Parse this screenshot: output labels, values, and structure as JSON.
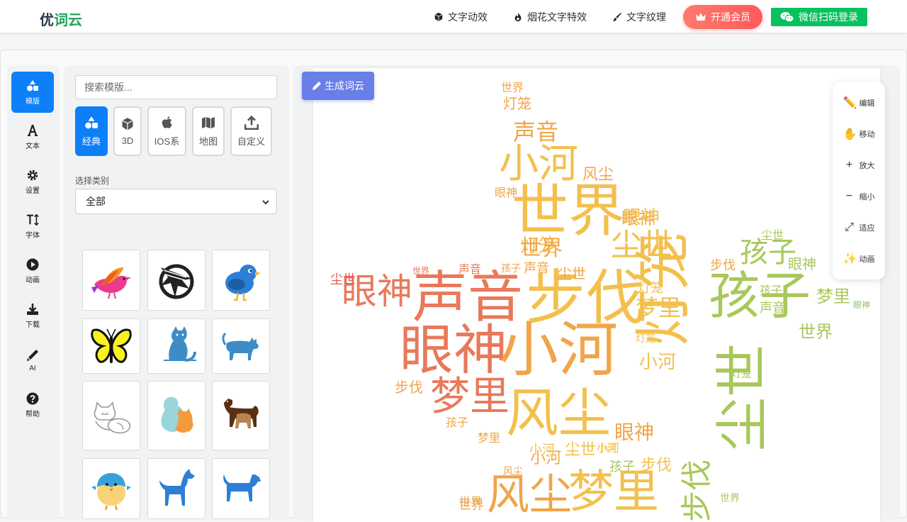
{
  "header": {
    "logo_part1": "优",
    "logo_part2": "词云",
    "nav": [
      {
        "label": "文字动效",
        "icon": "cube-icon"
      },
      {
        "label": "烟花文字特效",
        "icon": "fire-icon"
      },
      {
        "label": "文字纹理",
        "icon": "brush-icon"
      }
    ],
    "vip_label": "开通会员",
    "wechat_login_label": "微信扫码登录"
  },
  "sidebar": {
    "items": [
      {
        "label": "模版",
        "icon": "shapes-icon",
        "active": true
      },
      {
        "label": "文本",
        "icon": "text-icon"
      },
      {
        "label": "设置",
        "icon": "gear-icon"
      },
      {
        "label": "字体",
        "icon": "font-size-icon"
      },
      {
        "label": "动画",
        "icon": "play-icon"
      },
      {
        "label": "下载",
        "icon": "download-icon"
      },
      {
        "label": "AI",
        "icon": "pen-icon"
      },
      {
        "label": "帮助",
        "icon": "help-icon"
      }
    ]
  },
  "templates": {
    "search_placeholder": "搜索模版...",
    "categories": [
      {
        "label": "经典",
        "icon": "shapes-icon",
        "active": true
      },
      {
        "label": "3D",
        "icon": "cube-icon"
      },
      {
        "label": "IOS系",
        "icon": "apple-icon"
      },
      {
        "label": "地图",
        "icon": "map-icon"
      },
      {
        "label": "自定义",
        "icon": "upload-icon"
      }
    ],
    "select_label": "选择类别",
    "select_value": "全部",
    "thumbnails": [
      "bird-pink",
      "eagle-black",
      "bird-blue",
      "butterfly-yellow",
      "cat-blue",
      "cat-walking",
      "cats-outline",
      "cat-dog",
      "dogs-brown",
      "chick-blue",
      "dog-blue",
      "dog-blue-2"
    ]
  },
  "canvas": {
    "generate_label": "生成词云",
    "colors": [
      "#e8795a",
      "#f0a54a",
      "#f3c04d",
      "#a8c85a",
      "#8dc46e",
      "#e45c5c"
    ],
    "words": [
      {
        "text": "世界",
        "size": 16,
        "color": "#f0a54a"
      },
      {
        "text": "灯笼",
        "size": 20,
        "color": "#f0a54a"
      },
      {
        "text": "声音",
        "size": 32,
        "color": "#f0a54a"
      },
      {
        "text": "小河",
        "size": 60,
        "color": "#f3c04d"
      },
      {
        "text": "世界",
        "size": 80,
        "color": "#f3c04d"
      },
      {
        "text": "灯笼",
        "size": 26,
        "color": "#f3c04d"
      },
      {
        "text": "尘世",
        "size": 44,
        "color": "#f3c04d"
      },
      {
        "text": "世界",
        "size": 30,
        "color": "#f0a54a"
      },
      {
        "text": "眼神",
        "size": 24,
        "color": "#f0a54a"
      },
      {
        "text": "眼神",
        "size": 52,
        "color": "#e8795a"
      },
      {
        "text": "声音",
        "size": 80,
        "color": "#e8795a"
      },
      {
        "text": "步伐",
        "size": 84,
        "color": "#f3c04d"
      },
      {
        "text": "孩子",
        "size": 40,
        "color": "#a8c85a"
      },
      {
        "text": "孩子",
        "size": 76,
        "color": "#a8c85a"
      },
      {
        "text": "梦里",
        "size": 24,
        "color": "#a8c85a"
      },
      {
        "text": "眼神",
        "size": 78,
        "color": "#e8795a"
      },
      {
        "text": "小河",
        "size": 88,
        "color": "#f0a54a"
      },
      {
        "text": "灯笼",
        "size": 84,
        "color": "#f3c04d"
      },
      {
        "text": "尘世",
        "size": 80,
        "color": "#a8c85a"
      },
      {
        "text": "梦里",
        "size": 56,
        "color": "#e8795a"
      },
      {
        "text": "风尘",
        "size": 74,
        "color": "#f3c04d"
      },
      {
        "text": "眼神",
        "size": 28,
        "color": "#f0a54a"
      },
      {
        "text": "步伐",
        "size": 44,
        "color": "#a8c85a"
      },
      {
        "text": "风尘",
        "size": 60,
        "color": "#f0a54a"
      },
      {
        "text": "梦里",
        "size": 64,
        "color": "#f3c04d"
      },
      {
        "text": "世界",
        "size": 14,
        "color": "#e8795a"
      },
      {
        "text": "梦里",
        "size": 22,
        "color": "#f0a54a"
      },
      {
        "text": "孩子",
        "size": 20,
        "color": "#a8c85a"
      },
      {
        "text": "声音",
        "size": 18,
        "color": "#f0a54a"
      },
      {
        "text": "小河",
        "size": 22,
        "color": "#f0a54a"
      },
      {
        "text": "灯笼",
        "size": 18,
        "color": "#f3c04d"
      },
      {
        "text": "眼神",
        "size": 18,
        "color": "#f0a54a"
      },
      {
        "text": "风尘",
        "size": 22,
        "color": "#f0a54a"
      },
      {
        "text": "步伐",
        "size": 22,
        "color": "#f3c04d"
      },
      {
        "text": "尘世",
        "size": 22,
        "color": "#f3c04d"
      },
      {
        "text": "眼神",
        "size": 12,
        "color": "#8dc46e"
      },
      {
        "text": "声音",
        "size": 18,
        "color": "#a8c85a"
      },
      {
        "text": "世界",
        "size": 26,
        "color": "#a8c85a"
      },
      {
        "text": "眼神",
        "size": 28,
        "color": "#f3c04d"
      },
      {
        "text": "声音",
        "size": 18,
        "color": "#e8795a"
      },
      {
        "text": "尘世",
        "size": 20,
        "color": "#e45c5c"
      },
      {
        "text": "孩子",
        "size": 16,
        "color": "#f0a54a"
      },
      {
        "text": "步伐",
        "size": 20,
        "color": "#f0a54a"
      },
      {
        "text": "世界",
        "size": 20,
        "color": "#f0a54a"
      },
      {
        "text": "小河",
        "size": 26,
        "color": "#f3c04d"
      },
      {
        "text": "尘世",
        "size": 20,
        "color": "#f0a54a"
      },
      {
        "text": "小河",
        "size": 14,
        "color": "#f3c04d"
      },
      {
        "text": "风尘",
        "size": 14,
        "color": "#f0a54a"
      },
      {
        "text": "梦里",
        "size": 16,
        "color": "#f0a54a"
      },
      {
        "text": "小河",
        "size": 16,
        "color": "#f3c04d"
      },
      {
        "text": "灯笼",
        "size": 14,
        "color": "#a8c85a"
      },
      {
        "text": "世界",
        "size": 14,
        "color": "#a8c85a"
      },
      {
        "text": "尘世",
        "size": 16,
        "color": "#a8c85a"
      },
      {
        "text": "步伐",
        "size": 18,
        "color": "#f0a54a"
      },
      {
        "text": "孩子",
        "size": 16,
        "color": "#a8c85a"
      },
      {
        "text": "眼神",
        "size": 20,
        "color": "#a8c85a"
      },
      {
        "text": "孩子",
        "size": 18,
        "color": "#a8c85a"
      },
      {
        "text": "小河",
        "size": 18,
        "color": "#f3c04d"
      },
      {
        "text": "灯笼",
        "size": 14,
        "color": "#f3c04d"
      },
      {
        "text": "世界",
        "size": 16,
        "color": "#f0a54a"
      }
    ]
  },
  "tools": [
    {
      "label": "编辑",
      "icon": "pencil-icon",
      "glyph": "✏️"
    },
    {
      "label": "移动",
      "icon": "hand-icon",
      "glyph": "✋"
    },
    {
      "label": "放大",
      "icon": "plus-icon",
      "glyph": "+"
    },
    {
      "label": "缩小",
      "icon": "minus-icon",
      "glyph": "−"
    },
    {
      "label": "适应",
      "icon": "expand-icon",
      "glyph": "⤢"
    },
    {
      "label": "动画",
      "icon": "sparkles-icon",
      "glyph": "✨"
    }
  ]
}
